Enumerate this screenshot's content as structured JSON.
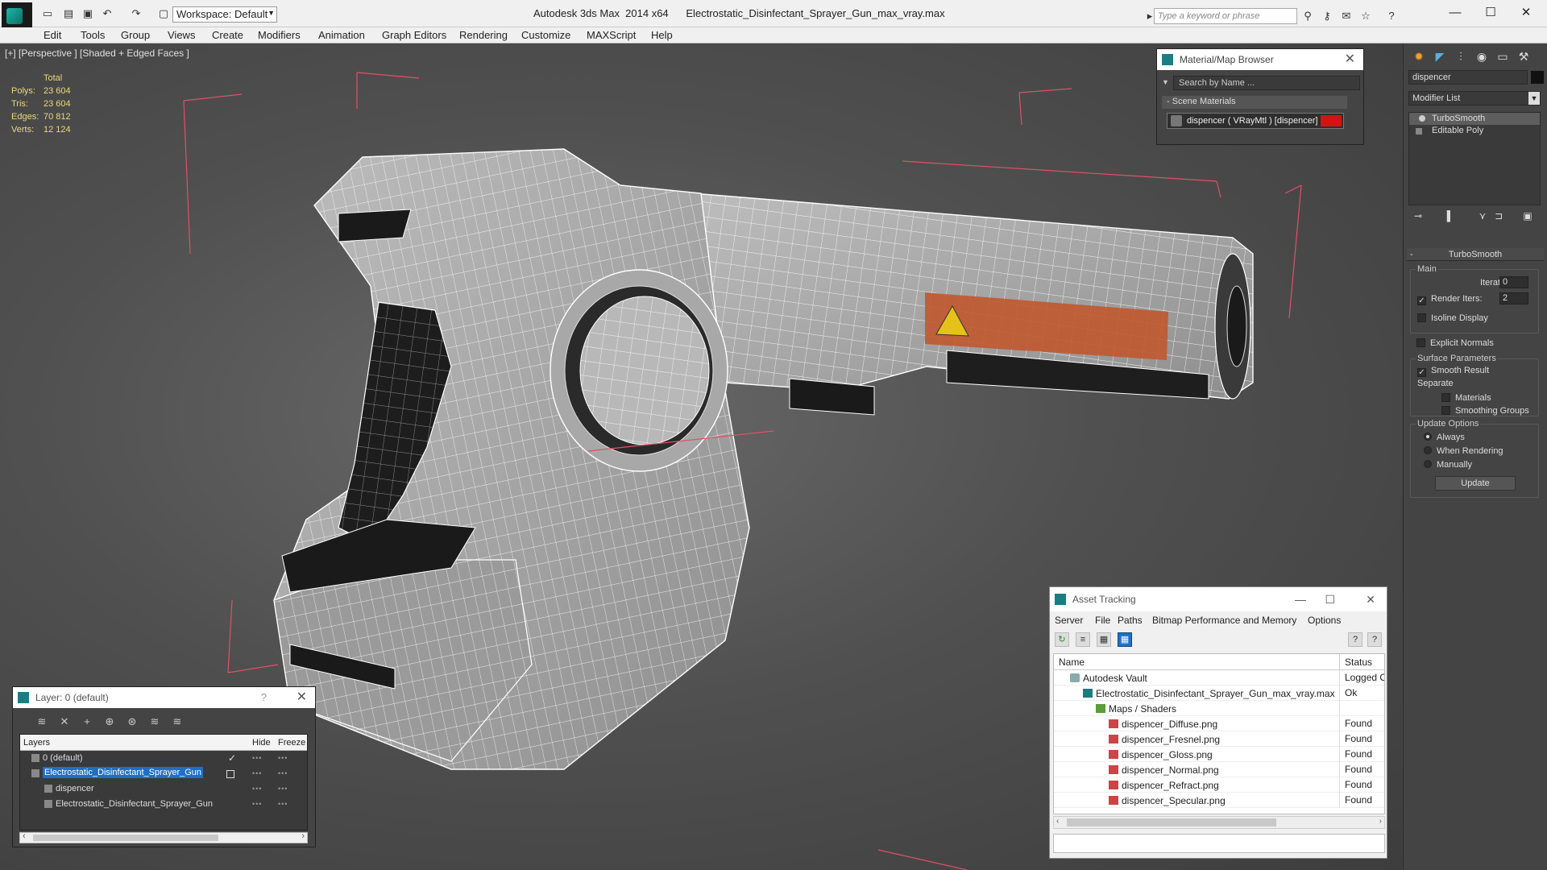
{
  "titlebar": {
    "workspace": "Workspace: Default",
    "window_title": "Autodesk 3ds Max  2014 x64      Electrostatic_Disinfectant_Sprayer_Gun_max_vray.max",
    "search_placeholder": "Type a keyword or phrase"
  },
  "menu": [
    "Edit",
    "Tools",
    "Group",
    "Views",
    "Create",
    "Modifiers",
    "Animation",
    "Graph Editors",
    "Rendering",
    "Customize",
    "MAXScript",
    "Help"
  ],
  "viewport": {
    "label": "[+] [Perspective ] [Shaded + Edged Faces ]",
    "stats_header": "Total",
    "stats": [
      {
        "label": "Polys:",
        "value": "23 604"
      },
      {
        "label": "Tris:",
        "value": "23 604"
      },
      {
        "label": "Edges:",
        "value": "70 812"
      },
      {
        "label": "Verts:",
        "value": "12 124"
      }
    ]
  },
  "material_browser": {
    "title": "Material/Map Browser",
    "search": "Search by Name ...",
    "section": "- Scene Materials",
    "item": "dispencer  ( VRayMtl )  [dispencer]",
    "swatch_color": "#d41414"
  },
  "command_panel": {
    "object_name": "dispencer",
    "modifier_list": "Modifier List",
    "stack": [
      "TurboSmooth",
      "Editable Poly"
    ],
    "turbosmooth": {
      "title": "TurboSmooth",
      "main_label": "Main",
      "iterations_label": "Iterations:",
      "iterations": "0",
      "render_iters_label": "Render Iters:",
      "render_iters": "2",
      "isoline": "Isoline Display",
      "explicit_normals": "Explicit Normals",
      "surface_label": "Surface Parameters",
      "smooth_result": "Smooth Result",
      "separate_label": "Separate",
      "materials": "Materials",
      "smoothing_groups": "Smoothing Groups",
      "update_options_label": "Update Options",
      "always": "Always",
      "when_rendering": "When Rendering",
      "manually": "Manually",
      "update_button": "Update"
    }
  },
  "asset_tracking": {
    "title": "Asset Tracking",
    "menu": [
      "Server",
      "File",
      "Paths",
      "Bitmap Performance and Memory",
      "Options"
    ],
    "col_name": "Name",
    "col_status": "Status",
    "rows": [
      {
        "name": "Autodesk Vault",
        "status": "Logged Ou",
        "indent": 1,
        "icon": "vault"
      },
      {
        "name": "Electrostatic_Disinfectant_Sprayer_Gun_max_vray.max",
        "status": "Ok",
        "indent": 2,
        "icon": "max"
      },
      {
        "name": "Maps / Shaders",
        "status": "",
        "indent": 3,
        "icon": "folder"
      },
      {
        "name": "dispencer_Diffuse.png",
        "status": "Found",
        "indent": 4,
        "icon": "png"
      },
      {
        "name": "dispencer_Fresnel.png",
        "status": "Found",
        "indent": 4,
        "icon": "png"
      },
      {
        "name": "dispencer_Gloss.png",
        "status": "Found",
        "indent": 4,
        "icon": "png"
      },
      {
        "name": "dispencer_Normal.png",
        "status": "Found",
        "indent": 4,
        "icon": "png"
      },
      {
        "name": "dispencer_Refract.png",
        "status": "Found",
        "indent": 4,
        "icon": "png"
      },
      {
        "name": "dispencer_Specular.png",
        "status": "Found",
        "indent": 4,
        "icon": "png"
      }
    ]
  },
  "layers": {
    "title": "Layer: 0 (default)",
    "help": "?",
    "col_layers": "Layers",
    "col_hide": "Hide",
    "col_freeze": "Freeze",
    "rows": [
      {
        "name": "0 (default)",
        "indent": 1,
        "selected": false,
        "current": true
      },
      {
        "name": "Electrostatic_Disinfectant_Sprayer_Gun",
        "indent": 1,
        "selected": true,
        "current": false
      },
      {
        "name": "dispencer",
        "indent": 2,
        "selected": false,
        "current": false
      },
      {
        "name": "Electrostatic_Disinfectant_Sprayer_Gun",
        "indent": 2,
        "selected": false,
        "current": false
      }
    ]
  },
  "colors": {
    "accent": "#1f6fc7",
    "stats_text": "#e8d97a",
    "bbox": "#e0506a"
  }
}
